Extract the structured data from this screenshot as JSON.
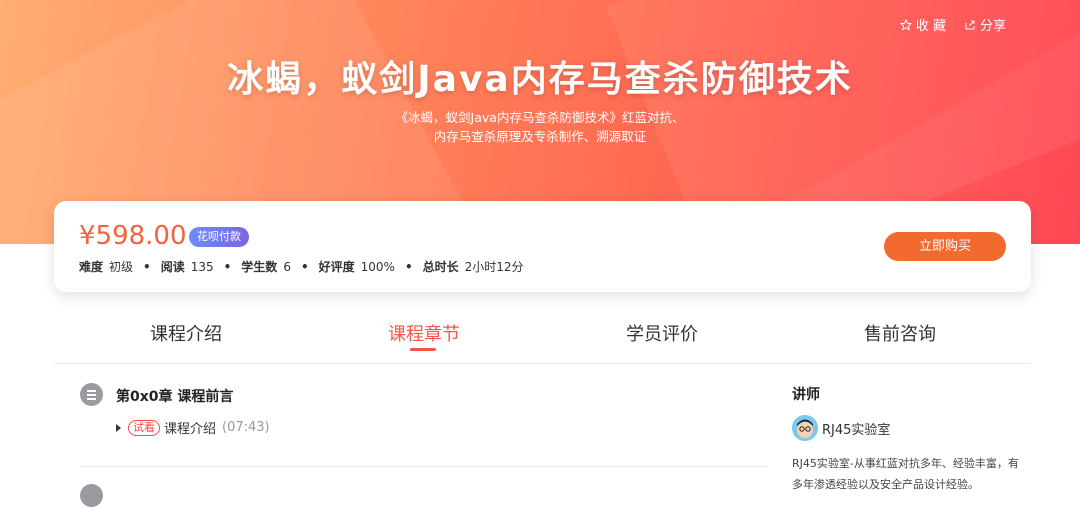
{
  "header": {
    "favorite_label": "收 藏",
    "share_label": "分享",
    "title": "冰蝎，蚁剑Java内存马查杀防御技术",
    "subtitle": "《冰蝎，蚁剑Java内存马查杀防御技术》红蓝对抗、内存马查杀原理及专杀制作、溯源取证"
  },
  "pricing": {
    "price": "¥598.00",
    "badge": "花呗付款",
    "buy_label": "立即购买",
    "stats": [
      {
        "key": "难度",
        "value": "初级"
      },
      {
        "key": "阅读",
        "value": "135"
      },
      {
        "key": "学生数",
        "value": "6"
      },
      {
        "key": "好评度",
        "value": "100%"
      },
      {
        "key": "总时长",
        "value": "2小时12分"
      }
    ],
    "separator": "•"
  },
  "tabs": [
    {
      "label": "课程介绍"
    },
    {
      "label": "课程章节"
    },
    {
      "label": "学员评价"
    },
    {
      "label": "售前咨询"
    }
  ],
  "active_tab_index": 1,
  "chapters": [
    {
      "title": "第0x0章 课程前言",
      "lessons": [
        {
          "tag": "试看",
          "title": "课程介绍",
          "duration": "(07:43)"
        }
      ]
    }
  ],
  "teacher": {
    "heading": "讲师",
    "name": "RJ45实验室",
    "description": "RJ45实验室-从事红蓝对抗多年、经验丰富，有多年渗透经验以及安全产品设计经验。"
  },
  "colors": {
    "accent": "#f2564a",
    "price": "#f2623f",
    "buy_button": "#f26a2e"
  }
}
